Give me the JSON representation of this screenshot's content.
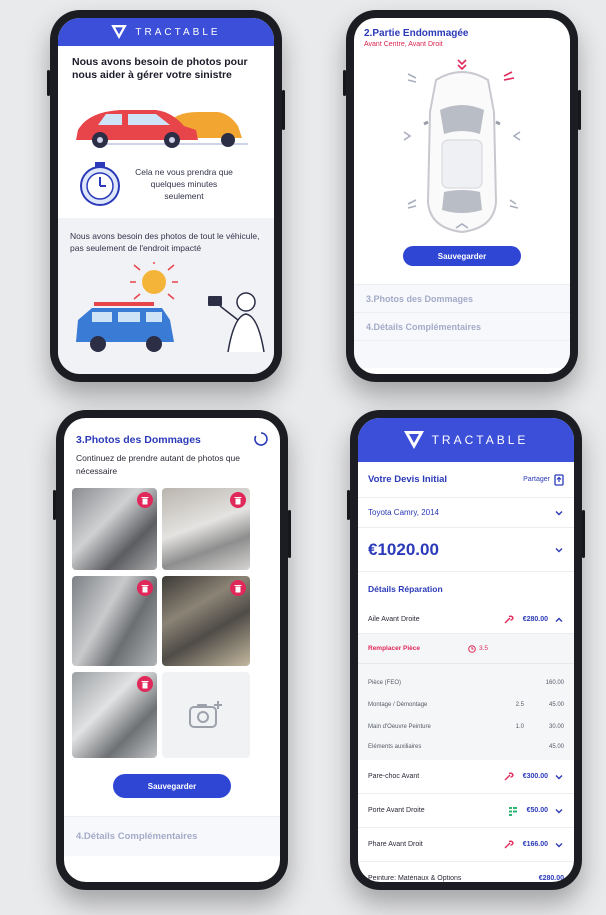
{
  "brand": {
    "name": "TRACTABLE",
    "color": "#3c4fd8"
  },
  "phone1": {
    "title": "Nous avons besoin de photos pour nous aider à gérer votre sinistre",
    "timer_text": "Cela ne vous prendra que quelques minutes seulement",
    "vehicle_text": "Nous avons besoin des photos de tout le véhicule, pas seulement de l'endroit impacté"
  },
  "phone2": {
    "title": "2.Partie Endommagée",
    "subtitle": "Avant Centre, Avant Droit",
    "save_label": "Sauvegarder",
    "next_sections": [
      "3.Photos des Dommages",
      "4.Détails Complémentaires"
    ]
  },
  "phone3": {
    "title": "3.Photos des Dommages",
    "instruction": "Continuez de prendre autant de photos que nécessaire",
    "add_photo_icon": "camera-plus-icon",
    "save_label": "Sauvegarder",
    "next_section": "4.Détails Complémentaires"
  },
  "phone4": {
    "header_title": "Votre Devis Initial",
    "share_label": "Partager",
    "vehicle": "Toyota Camry, 2014",
    "total": "€1020.00",
    "details_title": "Détails Réparation",
    "expanded_item": {
      "name": "Aile Avant Droite",
      "price": "€280.00",
      "action": "Remplacer Pièce",
      "hours": "3.5",
      "lines": [
        {
          "label": "Pièce (FEO)",
          "qty": "",
          "value": "160.00"
        },
        {
          "label": "Montage / Démontage",
          "qty": "2.5",
          "value": "45.00"
        },
        {
          "label": "Main d'Oeuvre Peinture",
          "qty": "1.0",
          "value": "30.00"
        },
        {
          "label": "Eléments auxiliaires",
          "qty": "",
          "value": "45.00"
        }
      ]
    },
    "items": [
      {
        "name": "Pare-choc Avant",
        "price": "€300.00",
        "icon": "wrench-icon"
      },
      {
        "name": "Porte Avant Droite",
        "price": "€50.00",
        "icon": "paint-icon"
      },
      {
        "name": "Phare Avant Droit",
        "price": "€166.00",
        "icon": "wrench-icon"
      },
      {
        "name": "Peinture: Matériaux & Options",
        "price": "€280.00",
        "icon": ""
      }
    ]
  }
}
